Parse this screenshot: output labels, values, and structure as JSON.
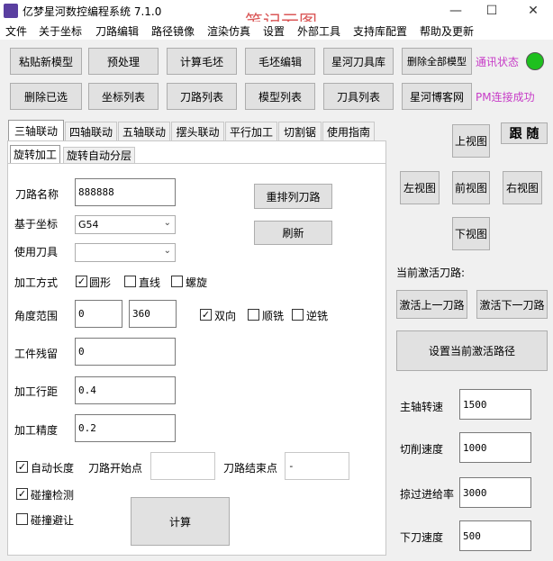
{
  "window": {
    "title": "亿梦星河数控编程系统  7.1.0",
    "watermark": "笔记云图",
    "min_glyph": "—",
    "max_glyph": "☐",
    "close_glyph": "✕"
  },
  "menu": [
    "文件",
    "关于坐标",
    "刀路编辑",
    "路径镜像",
    "渲染仿真",
    "设置",
    "外部工具",
    "支持库配置",
    "帮助及更新"
  ],
  "toolbar": {
    "row1": [
      "粘贴新模型",
      "预处理",
      "计算毛坯",
      "毛坯编辑",
      "星河刀具库",
      "删除全部模型"
    ],
    "row2": [
      "删除已选",
      "坐标列表",
      "刀路列表",
      "模型列表",
      "刀具列表",
      "星河博客网"
    ],
    "comm_status": "通讯状态",
    "pm_status": "PM连接成功"
  },
  "tabs": [
    "三轴联动",
    "四轴联动",
    "五轴联动",
    "摆头联动",
    "平行加工",
    "切割锯",
    "使用指南"
  ],
  "subtabs": [
    "旋转加工",
    "旋转自动分层"
  ],
  "form": {
    "toolpath_name_label": "刀路名称",
    "toolpath_name_value": "888888",
    "coord_label": "基于坐标",
    "coord_value": "G54",
    "tool_label": "使用刀具",
    "tool_value": "",
    "method_label": "加工方式",
    "method_options": [
      "圆形",
      "直线",
      "螺旋"
    ],
    "method_checked": [
      true,
      false,
      false
    ],
    "angle_label": "角度范围",
    "angle_min": "0",
    "angle_max": "360",
    "direction_options": [
      "双向",
      "顺铣",
      "逆铣"
    ],
    "direction_checked": [
      true,
      false,
      false
    ],
    "stock_label": "工件残留",
    "stock_value": "0",
    "stepover_label": "加工行距",
    "stepover_value": "0.4",
    "precision_label": "加工精度",
    "precision_value": "0.2",
    "auto_length_label": "自动长度",
    "auto_length_checked": true,
    "collision_check_label": "碰撞检测",
    "collision_check_checked": true,
    "collision_avoid_label": "碰撞避让",
    "collision_avoid_checked": false,
    "start_point_label": "刀路开始点",
    "start_point_value": "",
    "end_point_label": "刀路结束点",
    "end_point_value": "-",
    "reorder_button": "重排列刀路",
    "refresh_button": "刷新",
    "compute_button": "计算"
  },
  "views": {
    "top": "上视图",
    "left": "左视图",
    "front": "前视图",
    "right": "右视图",
    "bottom": "下视图",
    "follow": "跟 随"
  },
  "active_path": {
    "label": "当前激活刀路:",
    "prev": "激活上一刀路",
    "next": "激活下一刀路",
    "set_current": "设置当前激活路径"
  },
  "params": {
    "spindle_label": "主轴转速",
    "spindle_value": "1500",
    "cut_label": "切削速度",
    "cut_value": "1000",
    "plunge_label": "掠过进给率",
    "plunge_value": "3000",
    "down_label": "下刀速度",
    "down_value": "500"
  }
}
